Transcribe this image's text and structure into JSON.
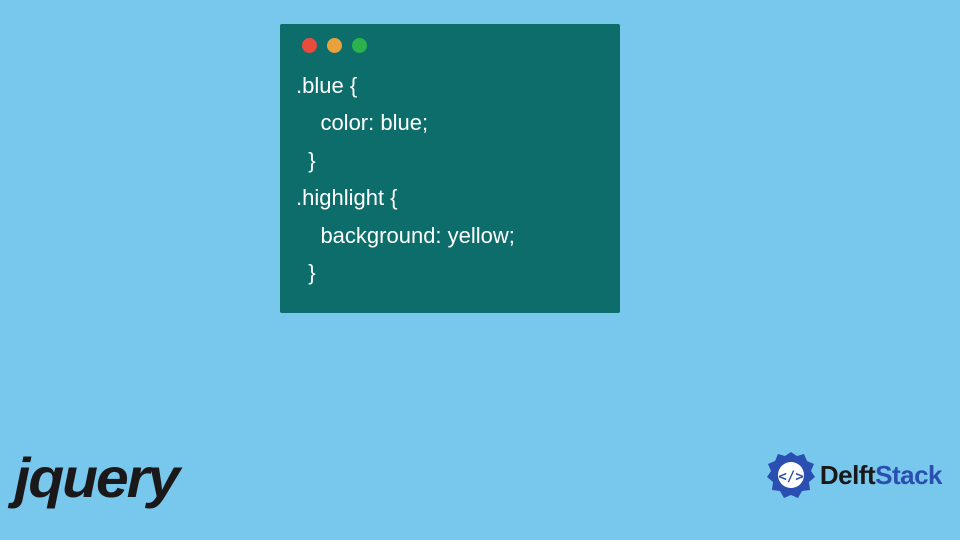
{
  "code_window": {
    "traffic_colors": {
      "red": "#e94b3c",
      "yellow": "#e9a13c",
      "green": "#2bb24c"
    },
    "bg": "#0d6d6a",
    "lines": [
      ".blue {",
      "    color: blue;",
      "  }",
      ".highlight {",
      "    background: yellow;",
      "  }"
    ]
  },
  "logos": {
    "jquery": "jQuery",
    "delftstack": {
      "prefix": "Delft",
      "suffix": "Stack",
      "icon_color": "#2a4fb0"
    }
  },
  "page_bg": "#78c8ee"
}
